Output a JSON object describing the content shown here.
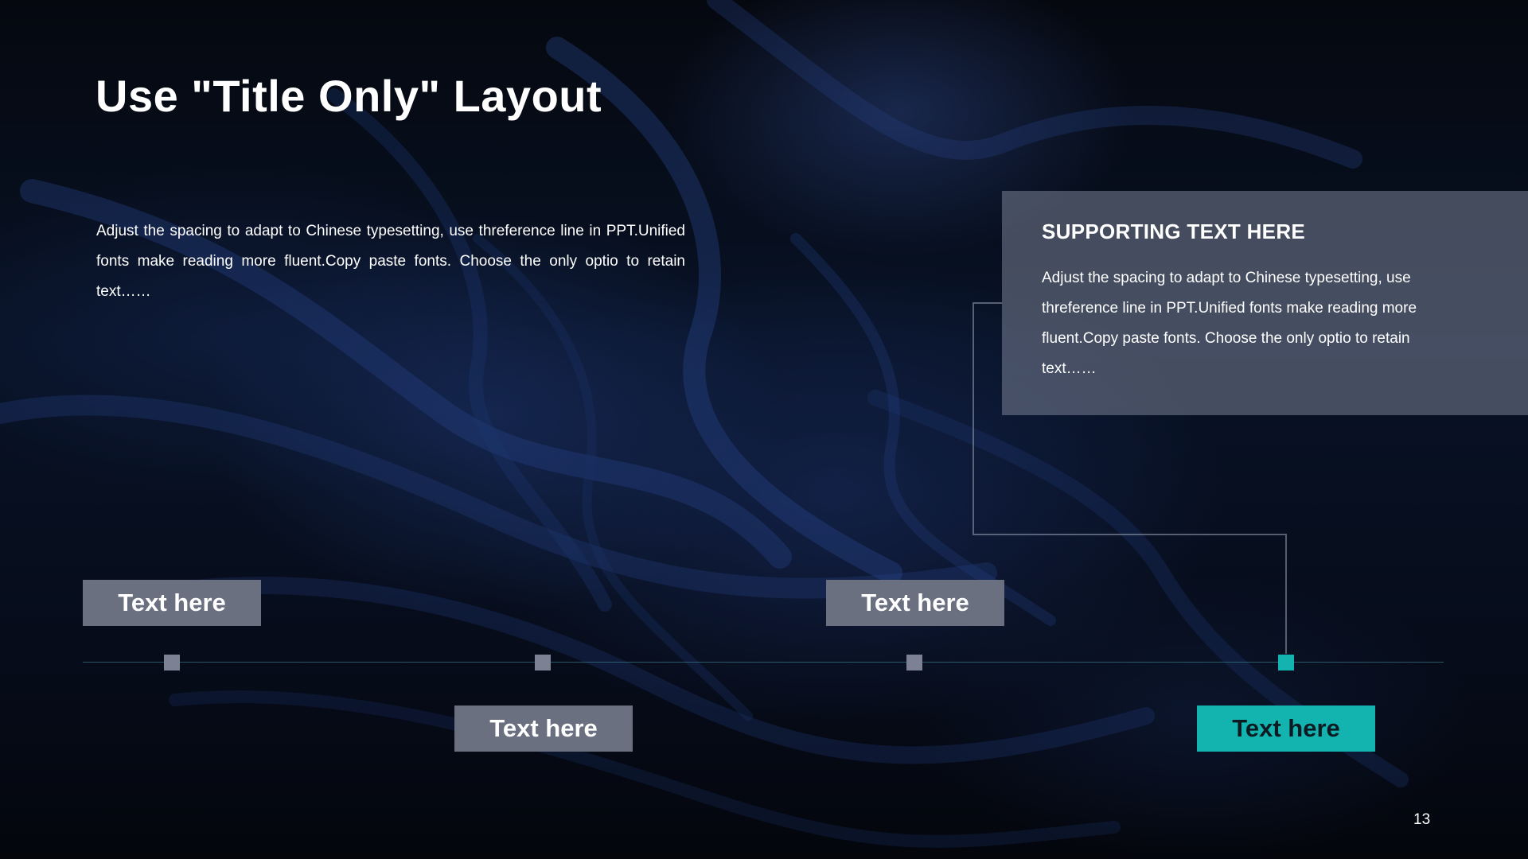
{
  "slide": {
    "title": "Use \"Title Only\" Layout",
    "intro_text": "Adjust the spacing to adapt to Chinese typesetting, use threference line in PPT.Unified fonts make reading more fluent.Copy paste fonts. Choose the only optio to retain text……",
    "page_number": "13"
  },
  "supporting": {
    "title": "SUPPORTING TEXT HERE",
    "body": "Adjust the spacing to adapt to Chinese typesetting, use threference line in PPT.Unified fonts make reading more fluent.Copy paste fonts. Choose the only optio to retain text……"
  },
  "timeline": {
    "labels": [
      "Text here",
      "Text here",
      "Text here",
      "Text here"
    ]
  },
  "colors": {
    "accent": "#13b4b0",
    "label_gray": "#6a7080",
    "background": "#04060c"
  }
}
